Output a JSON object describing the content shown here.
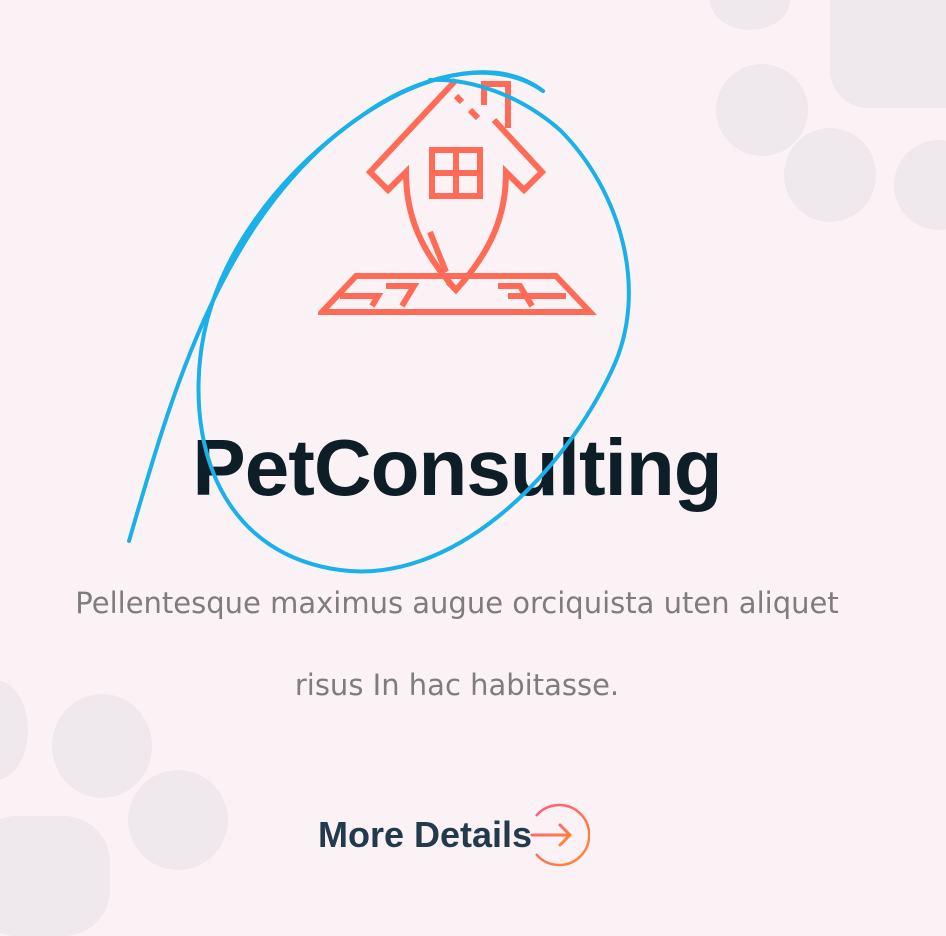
{
  "hero": {
    "title": "PetConsulting",
    "description_line1": "Pellentesque maximus augue orciquista uten aliquet",
    "description_line2": "risus In hac habitasse.",
    "more_label": "More Details"
  },
  "icons": {
    "hero_icon": "house-pin-icon",
    "more_icon": "arrow-right-circle-icon"
  },
  "colors": {
    "background": "#fbf2f5",
    "accent": "#ff6b57",
    "title": "#0e1e26",
    "body_text": "#7d7d7d",
    "link": "#233a4d",
    "annotation": "#1ab1ea",
    "paw": "#efe8ec"
  }
}
